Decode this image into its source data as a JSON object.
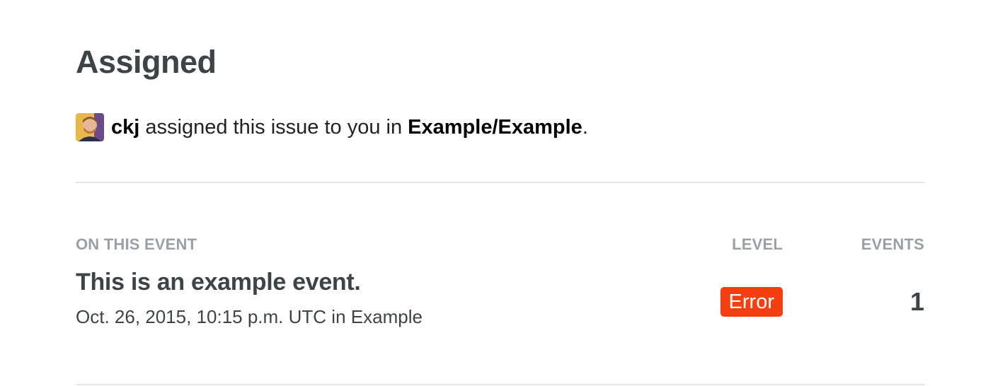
{
  "heading": "Assigned",
  "assignment": {
    "user": "ckj",
    "text": "assigned this issue to you in",
    "project": "Example/Example",
    "trailing": "."
  },
  "columns": {
    "on_event": "On this event",
    "level": "Level",
    "events": "Events"
  },
  "event": {
    "title": "This is an example event.",
    "timestamp": "Oct. 26, 2015, 10:15 p.m. UTC",
    "in_word": "in",
    "project": "Example",
    "level": "Error",
    "count": "1"
  },
  "colors": {
    "level_error": "#f43f13",
    "heading": "#3d4448",
    "column_header": "#9aa0a6",
    "divider": "#e2e4e6"
  },
  "icons": {
    "avatar": "user-avatar-photo"
  }
}
